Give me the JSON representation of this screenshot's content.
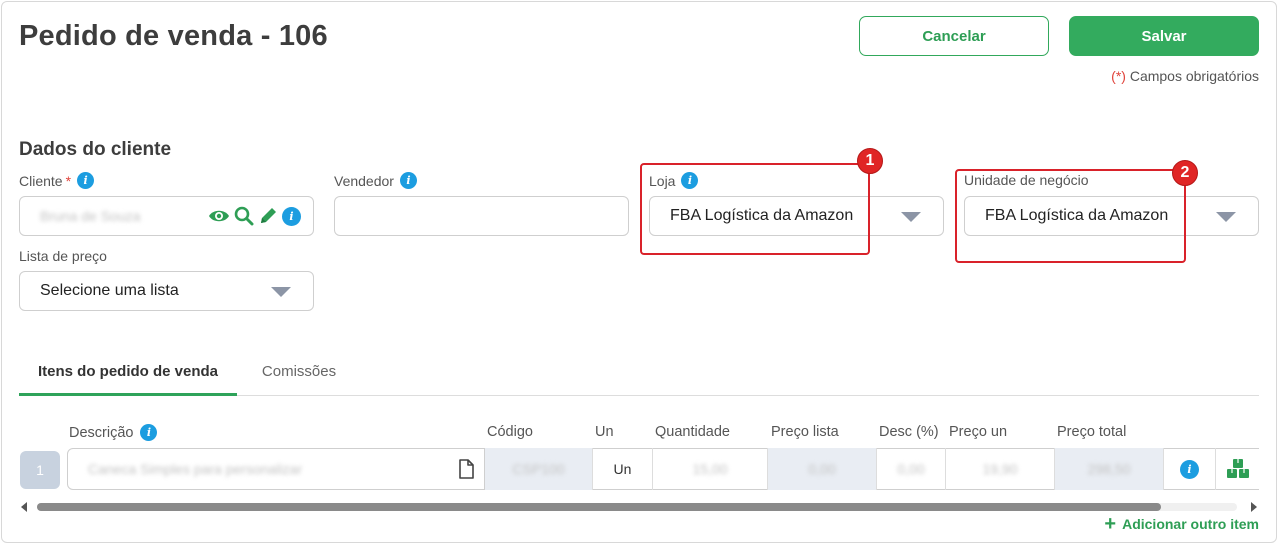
{
  "header": {
    "title": "Pedido de venda - 106",
    "cancel_label": "Cancelar",
    "save_label": "Salvar",
    "required_star": "(*)",
    "required_text": "Campos obrigatórios"
  },
  "client_section": {
    "title": "Dados do cliente",
    "client_label": "Cliente",
    "client_required": "*",
    "client_value": "Bruna de Souza",
    "seller_label": "Vendedor",
    "seller_value": "",
    "store_label": "Loja",
    "store_value": "FBA Logística da Amazon",
    "business_unit_label": "Unidade de negócio",
    "business_unit_value": "FBA Logística da Amazon",
    "price_list_label": "Lista de preço",
    "price_list_value": "Selecione uma lista"
  },
  "annotations": {
    "badge_1": "1",
    "badge_2": "2"
  },
  "tabs": {
    "items_label": "Itens do pedido de venda",
    "commissions_label": "Comissões"
  },
  "table": {
    "headers": {
      "description": "Descrição",
      "code": "Código",
      "unit": "Un",
      "quantity": "Quantidade",
      "list_price": "Preço lista",
      "discount": "Desc (%)",
      "unit_price": "Preço un",
      "total_price": "Preço total"
    },
    "rows": [
      {
        "index": "1",
        "description": "Caneca Simples para personalizar",
        "code": "CSP100",
        "unit": "Un",
        "quantity": "15,00",
        "list_price": "0,00",
        "discount": "0,00",
        "unit_price": "19,90",
        "total_price": "298,50"
      }
    ]
  },
  "add_item_label": "Adicionar outro item",
  "colors": {
    "primary": "#33ab5e",
    "info": "#1c9de0",
    "highlight": "#d9222a",
    "caret": "#8c95a6"
  }
}
